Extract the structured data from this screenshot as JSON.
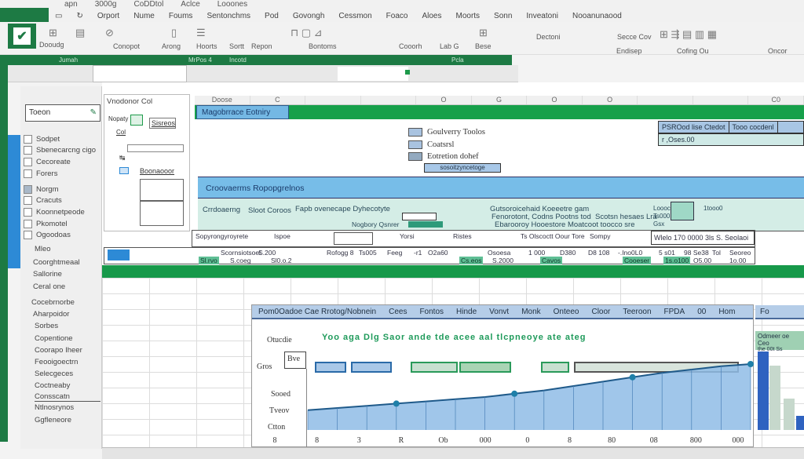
{
  "titlebar": {
    "top_menu": [
      "apn",
      "3000g",
      "CoDDtol",
      "Aclce",
      "Looones"
    ],
    "menu": [
      "Orport",
      "Nume",
      "Foums",
      "Sentonchms",
      "Pod",
      "Govongh",
      "Cessmon",
      "Foaco",
      "Aloes",
      "Moorts",
      "Sonn",
      "Inveatoni",
      "Nooanunaood"
    ]
  },
  "ribbon": {
    "groups": [
      "Dooudg",
      "Conopot",
      "Arong",
      "Hoorts",
      "Sortt",
      "Repon",
      "Bontoms",
      "Cooorh",
      "Lab G",
      "Bese",
      "Dectoni",
      "Secce Cov",
      "Endisep",
      "Cofing Ou",
      "Oncor"
    ],
    "green_bar_labels": [
      "Jumah",
      "MrPos 4",
      "Incotd",
      "Pcla"
    ]
  },
  "nav": {
    "search_value": "Toeon",
    "items": [
      "Sodpet",
      "Sbenecarcng cigo",
      "Cecoreate",
      "Forers",
      "Norgm",
      "Cracuts",
      "Koonnetpeode",
      "Pkomotel",
      "Ogoodoas",
      "Mleo",
      "Coorghtmeaal",
      "Sallorine",
      "Ceral one",
      "Cocebrnorbe",
      "Aharpoidor",
      "Sorbes",
      "Copentione",
      "Coorapo Iheer",
      "Feooigoectrn",
      "Selecgeces",
      "Coctneaby",
      "Consscatn",
      "Ntlnosrynos",
      "Ggfleneore"
    ]
  },
  "dialog": {
    "title": "Vnodonor Col",
    "field1": "Nopaty",
    "btn1": "Sisreos",
    "label2": "Col",
    "label3": "Boonaooor"
  },
  "sheet": {
    "columns": [
      "Doose",
      "C",
      "",
      "",
      "O",
      "G",
      "O",
      "O",
      "",
      "",
      "C0"
    ],
    "title": "Magobrrace Eotniry",
    "legend": [
      {
        "label": "Goulverry Toolos",
        "color": "#a9c3e0"
      },
      {
        "label": "Coatsrsl",
        "color": "#a9c3e0"
      },
      {
        "label": "Eotretion dohef",
        "color": "#93aac0"
      }
    ],
    "legend_bar": "sosoitzyncetoge",
    "info_r1": [
      "PSROod lise Ctedot",
      "Tooo cocdenl"
    ],
    "info_r2": "r ,Oses.00",
    "section_title": "Croovaerms Ropopgrelnos",
    "teal_texts": [
      "Crrdoaerng",
      "Sloot Coroos",
      "Fapb ovenecape Dyhecotyte",
      "Nogbory Qsnrer",
      "Gutsoroicehaid  Koeeetre gam",
      "Fenorotont, Codns Pootns tod",
      "Ebarooroy Hooestore Moatcoot toocco sre",
      "Scotsn hesaes Lra",
      "Loooc",
      "Ts000",
      "Gsx",
      "1tooo0"
    ],
    "row1": [
      "Sopyrongyroyrete",
      "Ispoe",
      "Yorsi",
      "Ristes",
      "Ts Olscoctt Oour Tore",
      "Sompy",
      "Wlelo  170 0000 3ls  S. Seolaoi"
    ],
    "row2": [
      "Scornsiotsoel",
      "S.200",
      "Rofogg 8",
      "Ts005",
      "Feeg",
      "-r1",
      "O2a60",
      "Osoesa",
      "1 000",
      "D380",
      "D8 108",
      "-.Ino0L0",
      "5 s01",
      "98 Se38",
      "Tol",
      "Seoreo"
    ],
    "row2_green": [
      "Sl.rvo",
      "S.coeg",
      "Sl0.o.2",
      "Cs.eos",
      "S.2000",
      "Cavos",
      "Cooeser",
      "1s.o100",
      "O5.00",
      "1o.00"
    ]
  },
  "chart": {
    "tabs": [
      "Pom0Oadoe Cae Rrotog/Nobnein",
      "Cees",
      "Fontos",
      "Hinde",
      "Vonvt",
      "Monk",
      "Onteeo",
      "Cloor",
      "Teeroon",
      "FPDA",
      "00",
      "Hom"
    ],
    "side_tab": "Fo",
    "side_box": [
      "Odmeer oe Ceo",
      "the 00t Ss"
    ],
    "row_labels": [
      "Otucdie",
      "Gros",
      "Sooed",
      "Tveov",
      "Ctton"
    ],
    "small_box": "Bve",
    "green_annotation": "Yoo aga Dlg Saor ande tde acee aal tlcpneoye ate ateg",
    "chart_data": {
      "type": "area",
      "title": "Pom0Oadoe Cae Rrotog/Nobnein",
      "xlabel": "",
      "ylabel": "",
      "x_tick_labels": [
        "8",
        "8",
        "3",
        "R",
        "Ob",
        "000",
        "0",
        "8",
        "80",
        "08",
        "800",
        "000"
      ],
      "series": [
        {
          "name": "area",
          "values": [
            18,
            20,
            22,
            24,
            26,
            28,
            30,
            33,
            36,
            40,
            44,
            48,
            52,
            55,
            58,
            60
          ]
        }
      ],
      "ylim": [
        0,
        100
      ],
      "grid": true
    }
  },
  "colors": {
    "excel_green": "#1d7a44",
    "band_blue": "#77bde8",
    "accent_green": "#16a04a"
  }
}
